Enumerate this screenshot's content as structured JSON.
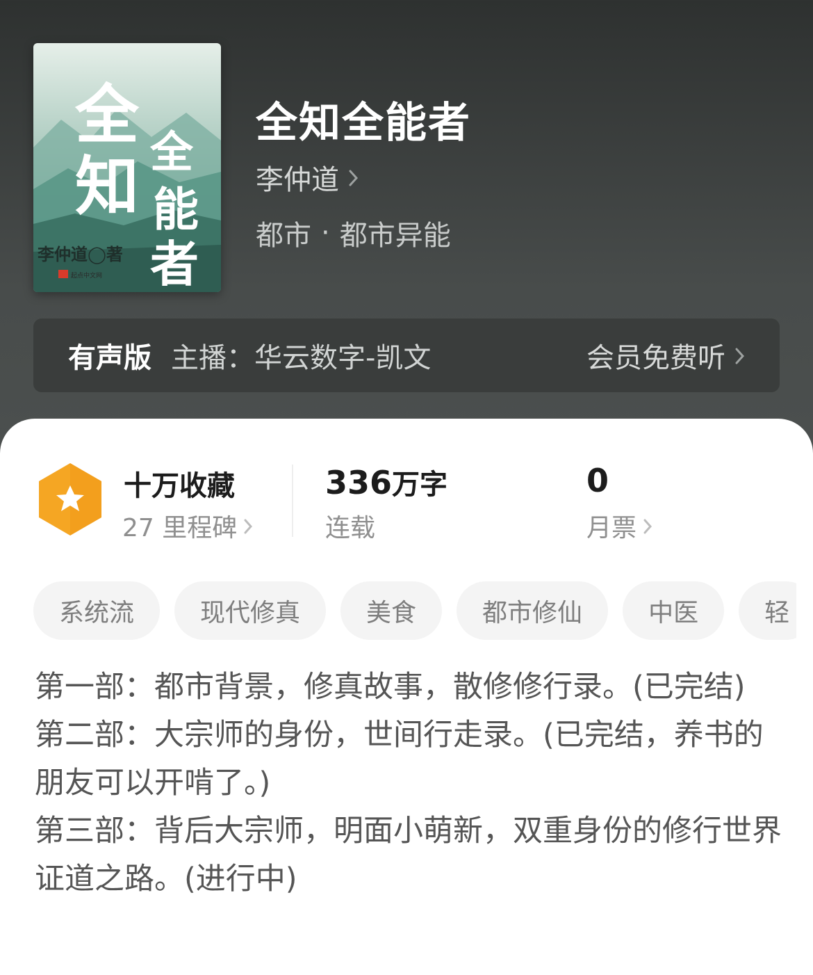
{
  "book": {
    "title": "全知全能者",
    "author": "李仲道",
    "category": "都市",
    "category_sep": "·",
    "subcategory": "都市异能",
    "cover": {
      "title_chars": [
        "全",
        "知",
        "全",
        "能",
        "者"
      ],
      "author_text": "李仲道◯著",
      "publisher_text": "起点中文网"
    }
  },
  "audio": {
    "label": "有声版",
    "host": "主播：华云数字-凯文",
    "action": "会员免费听"
  },
  "stats": {
    "collection": {
      "title": "十万收藏",
      "sub": "27 里程碑"
    },
    "words": {
      "number": "336",
      "unit": "万字",
      "sub": "连载"
    },
    "votes": {
      "number": "0",
      "sub": "月票"
    }
  },
  "tags": [
    "系统流",
    "现代修真",
    "美食",
    "都市修仙",
    "中医",
    "轻"
  ],
  "description": [
    "第一部：都市背景，修真故事，散修修行录。(已完结)",
    "第二部：大宗师的身份，世间行走录。(已完结，养书的朋友可以开啃了。)",
    "第三部：背后大宗师，明面小萌新，双重身份的修行世界证道之路。(进行中)"
  ],
  "colors": {
    "badge": "#f5a623",
    "header_bg": "#484c4b",
    "card_bg": "#ffffff"
  },
  "icons": [
    "chevron-right-icon",
    "star-badge-icon"
  ]
}
